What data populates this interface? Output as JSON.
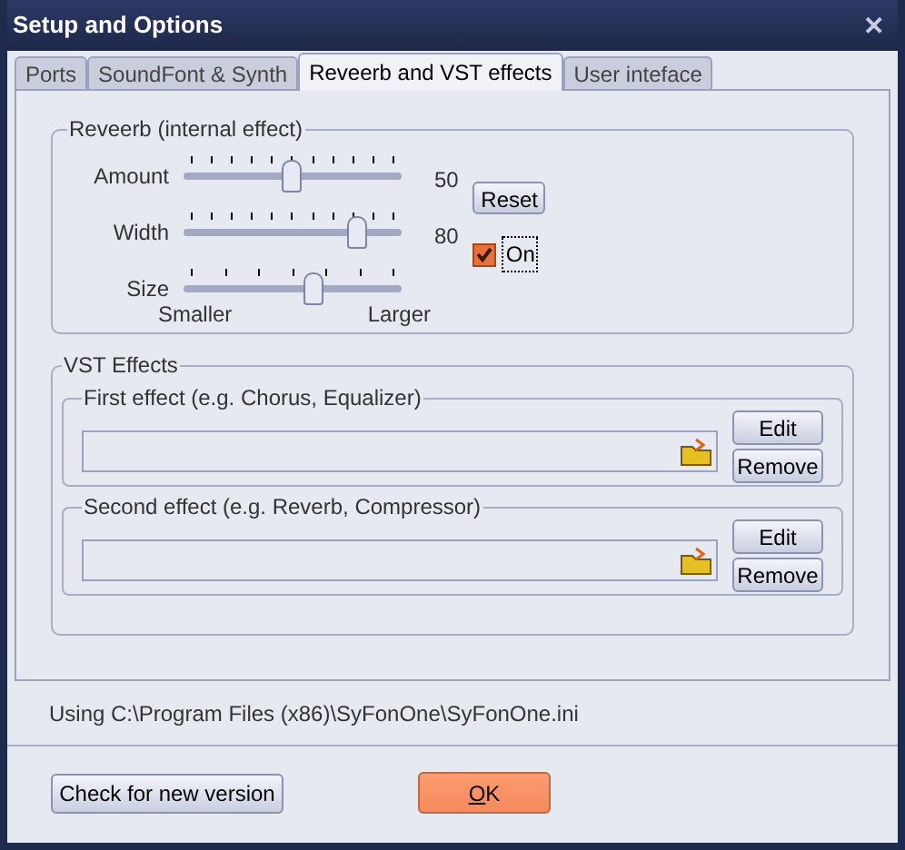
{
  "window": {
    "title": "Setup and Options",
    "close": "✕"
  },
  "tabs": [
    {
      "label": "Ports",
      "selected": false
    },
    {
      "label": "SoundFont & Synth",
      "selected": false
    },
    {
      "label": "Reveerb and VST effects",
      "selected": true
    },
    {
      "label": "User inteface",
      "selected": false
    }
  ],
  "reverb": {
    "title": "Reveerb (internal effect)",
    "sliders": [
      {
        "label": "Amount",
        "level": 0.5,
        "reading": "50"
      },
      {
        "label": "Width",
        "level": 0.8,
        "reading": "80"
      },
      {
        "label": "Size",
        "level": 0.6,
        "min_caption": "Smaller",
        "max_caption": "Larger"
      }
    ],
    "reset": "Reset",
    "on": {
      "label": "On",
      "checked": true
    }
  },
  "vst": {
    "title": "VST Effects",
    "effects": [
      {
        "title": "First effect (e.g. Chorus, Equalizer)",
        "edit": "Edit",
        "remove": "Remove"
      },
      {
        "title": "Second effect (e.g. Reverb, Compressor)",
        "edit": "Edit",
        "remove": "Remove"
      }
    ]
  },
  "status": "Using C:\\Program Files (x86)\\SyFonOne\\SyFonOne.ini",
  "buttons": {
    "check": "Check for new version",
    "ok": "OK"
  }
}
